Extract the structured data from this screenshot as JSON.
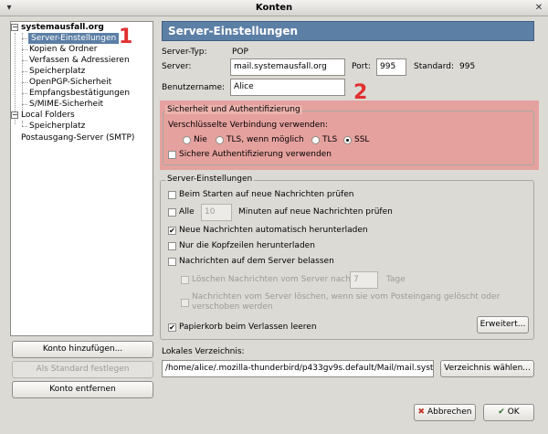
{
  "window": {
    "title": "Konten",
    "close_symbol": "✕",
    "menu_symbol": "▾"
  },
  "tree": {
    "accounts": [
      {
        "label": "systemausfall.org",
        "expanded": true,
        "children": [
          "Server-Einstellungen",
          "Kopien & Ordner",
          "Verfassen & Adressieren",
          "Speicherplatz",
          "OpenPGP-Sicherheit",
          "Empfangsbestätigungen",
          "S/MIME-Sicherheit"
        ]
      },
      {
        "label": "Local Folders",
        "expanded": true,
        "children": [
          "Speicherplatz"
        ]
      },
      {
        "label": "Postausgang-Server (SMTP)"
      }
    ],
    "selected": "Server-Einstellungen"
  },
  "left_buttons": {
    "add": "Konto hinzufügen...",
    "default": "Als Standard festlegen",
    "remove": "Konto entfernen"
  },
  "header": {
    "title": "Server-Einstellungen"
  },
  "server": {
    "type_label": "Server-Typ:",
    "type_value": "POP",
    "server_label": "Server:",
    "server_value": "mail.systemausfall.org",
    "port_label": "Port:",
    "port_value": "995",
    "standard_label": "Standard:",
    "standard_value": "995",
    "user_label": "Benutzername:",
    "user_value": "Alice"
  },
  "security": {
    "group_title": "Sicherheit und Authentifizierung",
    "encryption_label": "Verschlüsselte Verbindung verwenden:",
    "options": [
      "Nie",
      "TLS, wenn möglich",
      "TLS",
      "SSL"
    ],
    "selected": "SSL",
    "secure_auth_label": "Sichere Authentifizierung verwenden"
  },
  "settings": {
    "group_title": "Server-Einstellungen",
    "check_on_start": "Beim Starten auf neue Nachrichten prüfen",
    "check_every_pre": "Alle",
    "check_every_value": "10",
    "check_every_post": "Minuten auf neue Nachrichten prüfen",
    "auto_download": "Neue Nachrichten automatisch herunterladen",
    "headers_only": "Nur die Kopfzeilen herunterladen",
    "leave_on_server": "Nachrichten auf dem Server belassen",
    "delete_after_pre": "Löschen Nachrichten vom Server nach",
    "delete_after_value": "7",
    "delete_after_post": "Tage",
    "delete_when_removed": "Nachrichten vom Server löschen, wenn sie vom Posteingang gelöscht oder verschoben werden",
    "empty_trash": "Papierkorb beim Verlassen leeren",
    "advanced_button": "Erweitert..."
  },
  "local_dir": {
    "label": "Lokales Verzeichnis:",
    "value": "/home/alice/.mozilla-thunderbird/p433gv9s.default/Mail/mail.syste",
    "choose_button": "Verzeichnis wählen..."
  },
  "dialog_buttons": {
    "cancel": "Abbrechen",
    "ok": "OK",
    "cancel_icon": "✖",
    "ok_icon": "✔"
  },
  "markers": {
    "one": "1",
    "two": "2"
  },
  "colors": {
    "selection": "#5c7fa6",
    "highlight": "#f05a5a",
    "marker": "#e03030"
  }
}
